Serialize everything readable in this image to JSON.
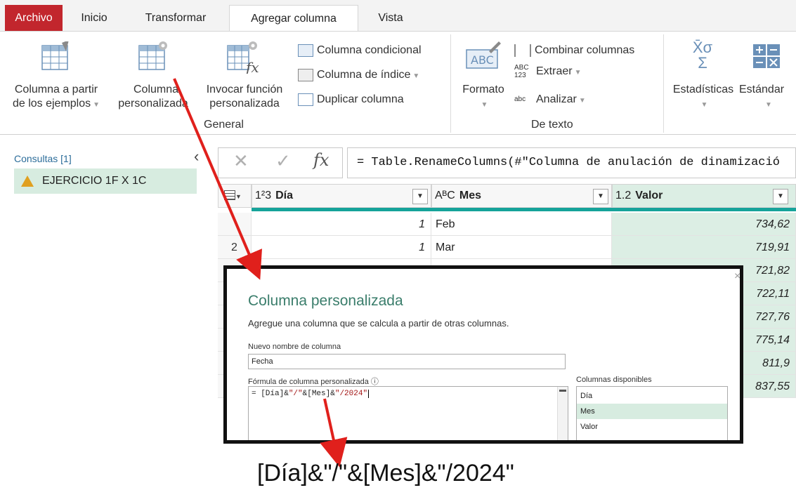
{
  "tabs": [
    {
      "label": "Archivo"
    },
    {
      "label": "Inicio"
    },
    {
      "label": "Transformar"
    },
    {
      "label": "Agregar columna"
    },
    {
      "label": "Vista"
    }
  ],
  "ribbon": {
    "column_from_examples": {
      "line1": "Columna a partir",
      "line2": "de los ejemplos"
    },
    "custom_column": {
      "line1": "Columna",
      "line2": "personalizada"
    },
    "invoke_function": {
      "line1": "Invocar función",
      "line2": "personalizada"
    },
    "conditional_column": "Columna condicional",
    "index_column": "Columna de índice",
    "duplicate_column": "Duplicar columna",
    "group_general": "General",
    "format": "Formato",
    "merge_columns": "Combinar columnas",
    "extract": "Extraer",
    "parse": "Analizar",
    "group_text": "De texto",
    "statistics": "Estadísticas",
    "standard": "Estándar",
    "icon_abc": "ABC",
    "icon_abc123_top": "ABC",
    "icon_abc123_bottom": "123",
    "icon_abc_small": "abc",
    "icon_stats_symbols": "X̄σ",
    "icon_sigma": "Σ",
    "icon_fx": "fx"
  },
  "left_panel": {
    "header": "Consultas [1]",
    "query": "EJERCICIO 1F X 1C"
  },
  "formula_bar": {
    "cancel_symbol": "✕",
    "commit_symbol": "✓",
    "fx_symbol": "fx",
    "text": "= Table.RenameColumns(#\"Columna de anulación de dinamizació"
  },
  "table": {
    "columns": [
      {
        "type": "1²3",
        "name": "Día"
      },
      {
        "type": "AᴮC",
        "name": "Mes"
      },
      {
        "type": "1.2",
        "name": "Valor"
      }
    ],
    "rows": [
      {
        "num": "",
        "dia": "1",
        "mes": "Feb",
        "valor": "734,62"
      },
      {
        "num": "2",
        "dia": "1",
        "mes": "Mar",
        "valor": "719,91"
      },
      {
        "num": "",
        "dia": "",
        "mes": "",
        "valor": "721,82"
      },
      {
        "num": "",
        "dia": "",
        "mes": "",
        "valor": "722,11"
      },
      {
        "num": "",
        "dia": "",
        "mes": "",
        "valor": "727,76"
      },
      {
        "num": "",
        "dia": "",
        "mes": "",
        "valor": "775,14"
      },
      {
        "num": "",
        "dia": "",
        "mes": "",
        "valor": "811,9"
      },
      {
        "num": "",
        "dia": "",
        "mes": "",
        "valor": "837,55"
      }
    ]
  },
  "dialog": {
    "title": "Columna personalizada",
    "subtitle": "Agregue una columna que se calcula a partir de otras columnas.",
    "name_label": "Nuevo nombre de columna",
    "name_value": "Fecha",
    "formula_label": "Fórmula de columna personalizada",
    "info_icon": "ⓘ",
    "formula_prefix": "= ",
    "formula_part1": "[Día]&",
    "formula_part2": "\"/\"",
    "formula_part3": "&[Mes]&",
    "formula_part4": "\"/2024\"",
    "available_label": "Columnas disponibles",
    "available": [
      "Día",
      "Mes",
      "Valor"
    ],
    "close_symbol": "×"
  },
  "big_formula": "[Día]&\"/\"&[Mes]&\"/2024\"",
  "colors": {
    "file_tab": "#c2262d",
    "accent_teal": "#16a39a",
    "selected_green": "#d7ece0",
    "arrow_red": "#e0201c",
    "dialog_title": "#3a7d6b"
  }
}
